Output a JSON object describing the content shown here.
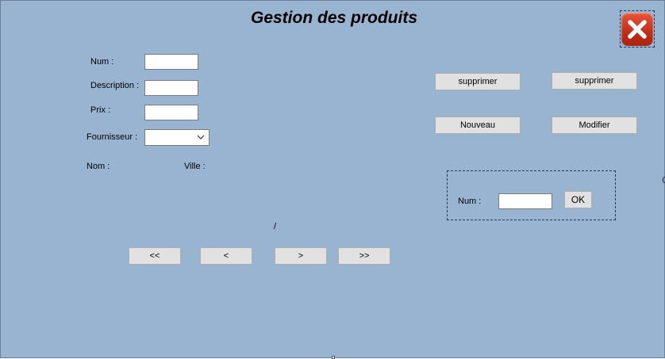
{
  "form": {
    "title": "Gestion des produits"
  },
  "fields": {
    "num_label": "Num :",
    "num_value": "",
    "description_label": "Description :",
    "description_value": "",
    "prix_label": "Prix :",
    "prix_value": "",
    "fournisseur_label": "Fournisseur :",
    "fournisseur_value": ""
  },
  "supplier_info": {
    "nom_label": "Nom :",
    "ville_label": "Ville  :"
  },
  "navigation": {
    "position_separator": "/",
    "first_label": "<<",
    "previous_label": "<",
    "next_label": ">",
    "last_label": ">>"
  },
  "actions": {
    "supprimer_1_label": "supprimer",
    "supprimer_2_label": "supprimer",
    "nouveau_label": "Nouveau",
    "modifier_label": "Modifier"
  },
  "search": {
    "num_label": "Num :",
    "num_value": "",
    "ok_label": "OK"
  },
  "colors": {
    "form_background": "#99b4d1",
    "button_face": "#e1e1e1",
    "close_button": "#c5301a"
  },
  "icons": {
    "close": "close-icon",
    "dropdown": "chevron-down-icon"
  }
}
